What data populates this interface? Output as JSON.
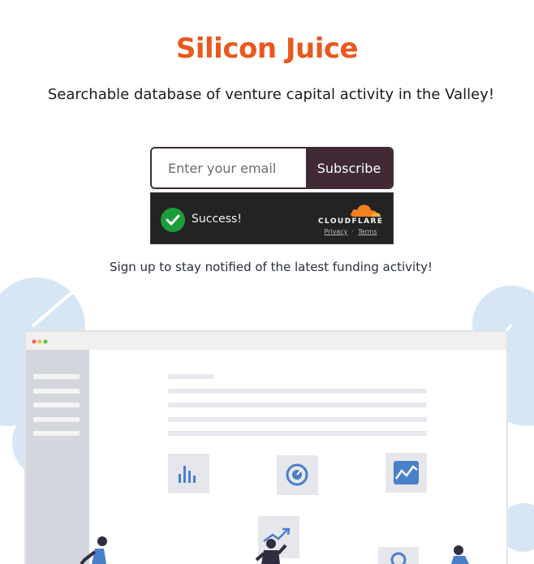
{
  "header": {
    "title": "Silicon Juice",
    "subtitle": "Searchable database of venture capital activity in the Valley!"
  },
  "signup": {
    "email_placeholder": "Enter your email",
    "subscribe_label": "Subscribe"
  },
  "captcha": {
    "status": "Success!",
    "brand": "CLOUDFLARE",
    "privacy_label": "Privacy",
    "separator": "·",
    "terms_label": "Terms"
  },
  "note": "Sign up to stay notified of the latest funding activity!",
  "colors": {
    "title": "#e8581f",
    "button": "#3f2a35",
    "captcha_bg": "#232323",
    "success": "#1d9d3a",
    "cloudflare_orange": "#f38020",
    "leaf": "#d6e6f5",
    "chart_icon": "#4a7fc9"
  },
  "icons": [
    "check-icon",
    "cloudflare-cloud-icon",
    "bar-chart-icon",
    "speedometer-icon",
    "line-chart-icon"
  ]
}
